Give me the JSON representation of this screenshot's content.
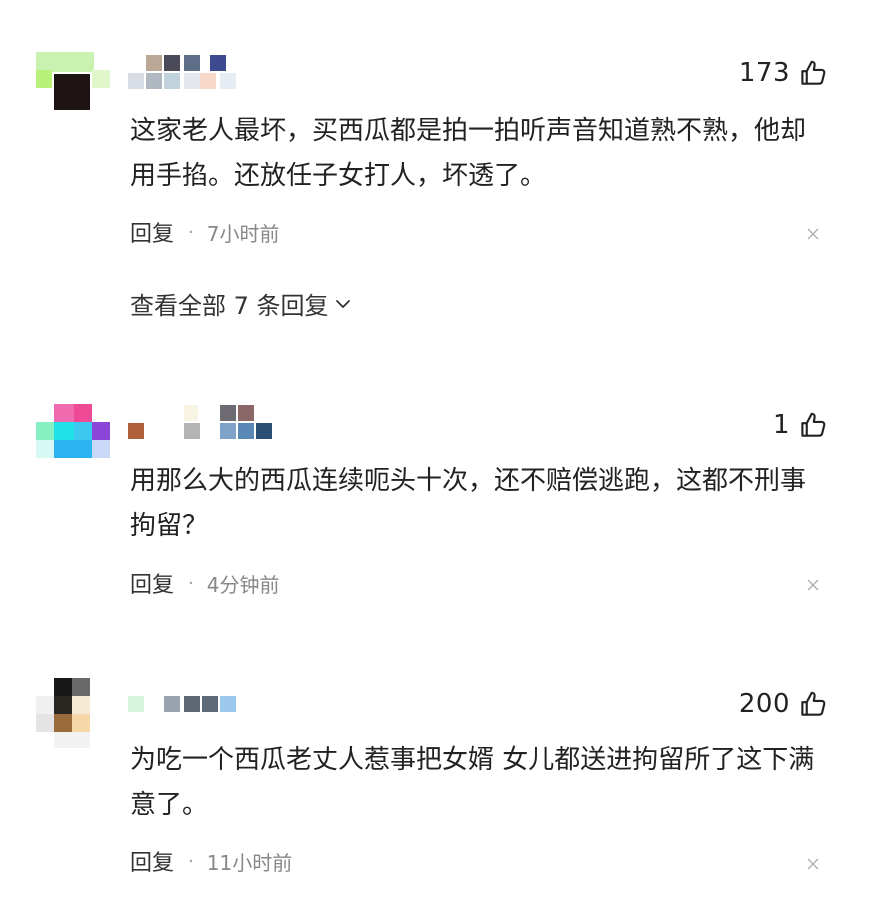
{
  "comments": [
    {
      "likes": "173",
      "text": "这家老人最坏，买西瓜都是拍一拍听声音知道熟不熟，他却用手掐。还放任子女打人，坏透了。",
      "reply_label": "回复",
      "separator": "·",
      "time": "7小时前",
      "view_replies": "查看全部 7 条回复"
    },
    {
      "likes": "1",
      "text": "用那么大的西瓜连续呃头十次，还不赔偿逃跑，这都不刑事拘留？",
      "reply_label": "回复",
      "separator": "·",
      "time": "4分钟前"
    },
    {
      "likes": "200",
      "text": "为吃一个西瓜老丈人惹事把女婿 女儿都送进拘留所了这下满意了。",
      "reply_label": "回复",
      "separator": "·",
      "time": "11小时前"
    }
  ],
  "icons": {
    "like": "thumbs-up-icon",
    "close": "close-icon",
    "expand": "chevron-down-icon"
  }
}
